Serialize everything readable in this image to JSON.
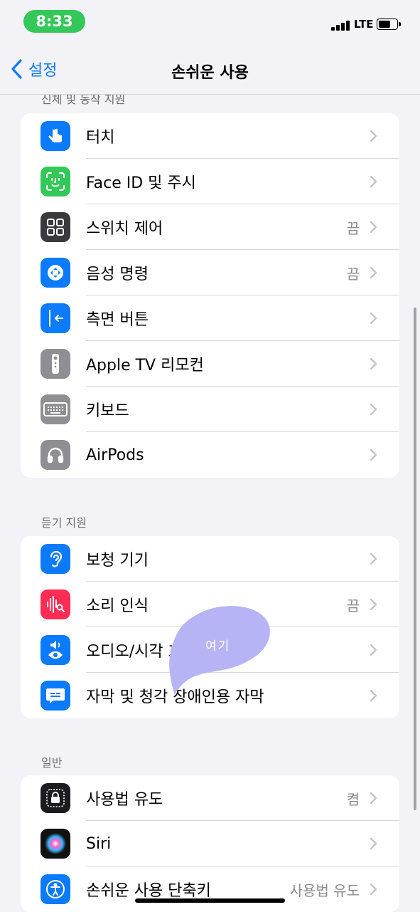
{
  "status_bar": {
    "time": "8:33",
    "network": "LTE",
    "time_pill_color": "#34c759"
  },
  "nav": {
    "back_label": "설정",
    "title": "손쉬운 사용"
  },
  "sections": {
    "physical": {
      "header": "신체 및 동작 지원",
      "items": [
        {
          "label": "터치",
          "value": "",
          "icon": "hand-touch-icon",
          "icon_color": "#0a7aff"
        },
        {
          "label": "Face ID 및 주시",
          "value": "",
          "icon": "face-id-icon",
          "icon_color": "#34c759"
        },
        {
          "label": "스위치 제어",
          "value": "끔",
          "icon": "switch-control-icon",
          "icon_color": "#3a3a3c"
        },
        {
          "label": "음성 명령",
          "value": "끔",
          "icon": "voice-control-icon",
          "icon_color": "#0a7aff"
        },
        {
          "label": "측면 버튼",
          "value": "",
          "icon": "side-button-icon",
          "icon_color": "#0a7aff"
        },
        {
          "label": "Apple TV 리모컨",
          "value": "",
          "icon": "tv-remote-icon",
          "icon_color": "#8e8e93"
        },
        {
          "label": "키보드",
          "value": "",
          "icon": "keyboard-icon",
          "icon_color": "#8e8e93"
        },
        {
          "label": "AirPods",
          "value": "",
          "icon": "airpods-icon",
          "icon_color": "#8e8e93"
        }
      ]
    },
    "hearing": {
      "header": "듣기 지원",
      "items": [
        {
          "label": "보청 기기",
          "value": "",
          "icon": "ear-icon",
          "icon_color": "#0a7aff"
        },
        {
          "label": "소리 인식",
          "value": "끔",
          "icon": "sound-recognition-icon",
          "icon_color": "#ff2d55"
        },
        {
          "label": "오디오/시각 효과",
          "value": "",
          "icon": "audio-visual-icon",
          "icon_color": "#0a7aff"
        },
        {
          "label": "자막 및 청각 장애인용 자막",
          "value": "",
          "icon": "subtitles-icon",
          "icon_color": "#0a7aff"
        }
      ]
    },
    "general": {
      "header": "일반",
      "items": [
        {
          "label": "사용법 유도",
          "value": "켬",
          "icon": "guided-access-icon",
          "icon_color": "#1c1c1e"
        },
        {
          "label": "Siri",
          "value": "",
          "icon": "siri-icon",
          "icon_color": "#111111"
        },
        {
          "label": "손쉬운 사용 단축키",
          "value": "사용법 유도",
          "icon": "accessibility-shortcut-icon",
          "icon_color": "#0a7aff"
        }
      ]
    }
  },
  "annotation": {
    "text": "여기",
    "color": "#b7b4f5"
  }
}
